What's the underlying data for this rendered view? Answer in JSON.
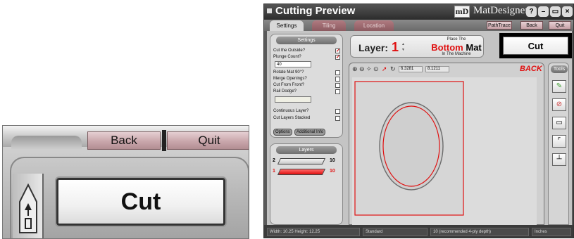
{
  "zoom": {
    "back_label": "Back",
    "quit_label": "Quit",
    "cut_label": "Cut"
  },
  "app": {
    "title": "Cutting Preview",
    "logo_text": "mD",
    "brand": "MatDesigner",
    "window_buttons": [
      "?",
      "–",
      "▭",
      "×"
    ],
    "tabs": [
      "Settings",
      "Tiling",
      "Location"
    ],
    "toolbar": {
      "pathtrace": "PathTrace",
      "back": "Back",
      "quit": "Quit"
    },
    "settings": {
      "heading": "Settings",
      "options": [
        {
          "label": "Cut the Outside?",
          "checked": true
        },
        {
          "label": "Plunge Count?",
          "checked": true
        },
        {
          "label": "Rotate Mat 90°?",
          "checked": false
        },
        {
          "label": "Merge Openings?",
          "checked": false
        },
        {
          "label": "Cut From Front?",
          "checked": false
        },
        {
          "label": "Rail Dodge?",
          "checked": false
        },
        {
          "label": "Continuous Layer?",
          "checked": false
        },
        {
          "label": "Cut Layers Stacked",
          "checked": false
        }
      ],
      "plunge_value": "40",
      "rail_value": "",
      "tab_options": "Options",
      "tab_additional": "Additional Info"
    },
    "layers": {
      "heading": "Layers",
      "rows": [
        {
          "left": "2",
          "right": "10",
          "color": "#c8c8c8"
        },
        {
          "left": "1",
          "right": "10",
          "color": "#e01010"
        }
      ]
    },
    "layer_box": {
      "label": "Layer:",
      "value": "1",
      "place_line1": "Place The",
      "place_bottom": "Bottom",
      "place_mat": "Mat",
      "place_line3": "In The Machine"
    },
    "cut_button": "Cut",
    "preview": {
      "coord_x": "6.3281",
      "coord_y": "8.1211",
      "back_label": "BACK"
    },
    "tools": {
      "heading": "Tools",
      "icons": [
        "pen-icon",
        "erase-icon",
        "square-icon",
        "corner-icon",
        "split-icon"
      ]
    },
    "status": {
      "size": "Width: 10.25  Height: 12.25",
      "style": "Standard",
      "depth": "10  (recommended 4-ply depth)",
      "units": "Inches"
    }
  }
}
